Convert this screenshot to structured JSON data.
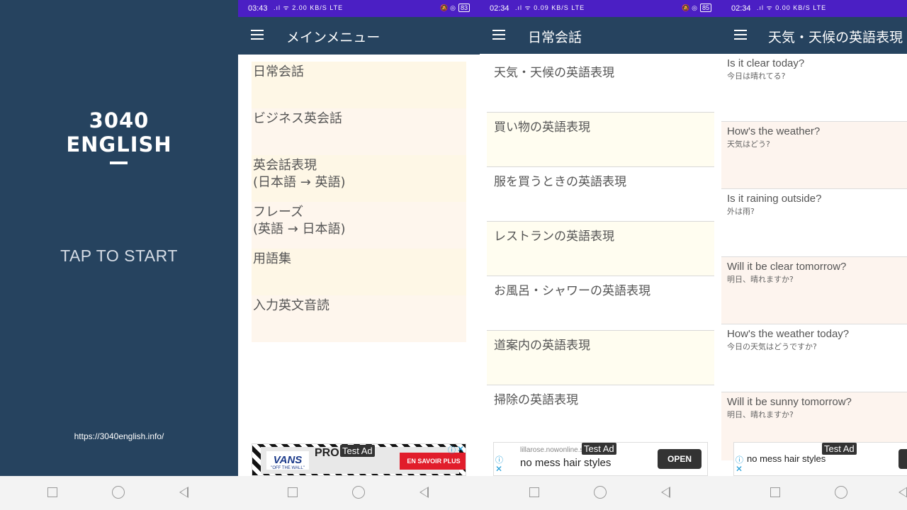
{
  "splash": {
    "logo_line1": "3040",
    "logo_line2": "ENGLISH",
    "tap_to_start": "TAP TO START",
    "url": "https://3040english.info/",
    "bg_color": "#26435f"
  },
  "main_menu_screen": {
    "status": {
      "time": "03:43",
      "net": "2.00 KB/S LTE",
      "battery": "83"
    },
    "title": "メインメニュー",
    "items": [
      {
        "line1": "日常会話",
        "line2": ""
      },
      {
        "line1": "ビジネス英会話",
        "line2": ""
      },
      {
        "line1": "英会話表現",
        "line2": "(日本語 → 英語)"
      },
      {
        "line1": "フレーズ",
        "line2": "(英語 → 日本語)"
      },
      {
        "line1": "用語集",
        "line2": ""
      },
      {
        "line1": "入力英文音読",
        "line2": ""
      }
    ],
    "ad": {
      "label": "Test Ad",
      "brand": "VANS",
      "brand_sub": "\"OFF THE WALL\"",
      "cta": "EN SAVOIR PLUS",
      "headline_fragment": "PRO"
    }
  },
  "daily_screen": {
    "status": {
      "time": "02:34",
      "net": "0.09 KB/S LTE",
      "battery": "85"
    },
    "title": "日常会話",
    "topics": [
      "天気・天候の英語表現",
      "買い物の英語表現",
      "服を買うときの英語表現",
      "レストランの英語表現",
      "お風呂・シャワーの英語表現",
      "道案内の英語表現",
      "掃除の英語表現"
    ],
    "ad": {
      "label": "Test Ad",
      "site": "lillarose.nowonline.site",
      "headline": "no mess hair styles",
      "cta": "OPEN"
    }
  },
  "weather_screen": {
    "status": {
      "time": "02:34",
      "net": "0.00 KB/S LTE"
    },
    "title": "天気・天候の英語表現",
    "phrases": [
      {
        "en": "Is it clear today?",
        "ja": "今日は晴れてる?"
      },
      {
        "en": "How's the weather?",
        "ja": "天気はどう?"
      },
      {
        "en": "Is it raining outside?",
        "ja": "外は雨?"
      },
      {
        "en": "Will it be clear tomorrow?",
        "ja": "明日、晴れますか?"
      },
      {
        "en": "How's the weather today?",
        "ja": "今日の天気はどうですか?"
      },
      {
        "en": "Will it be sunny tomorrow?",
        "ja": "明日、晴れますか?"
      }
    ],
    "ad": {
      "label": "Test Ad",
      "headline": "no mess hair styles"
    }
  },
  "icons": {
    "menu": "hamburger-icon",
    "nav_recent": "square-icon",
    "nav_home": "circle-icon",
    "nav_back": "triangle-back-icon",
    "ad_info": "info-icon",
    "ad_close": "close-icon"
  },
  "colors": {
    "toolbar": "#26435f",
    "status_bar": "#4b1fc4",
    "item_tint": "#fef6ed"
  }
}
